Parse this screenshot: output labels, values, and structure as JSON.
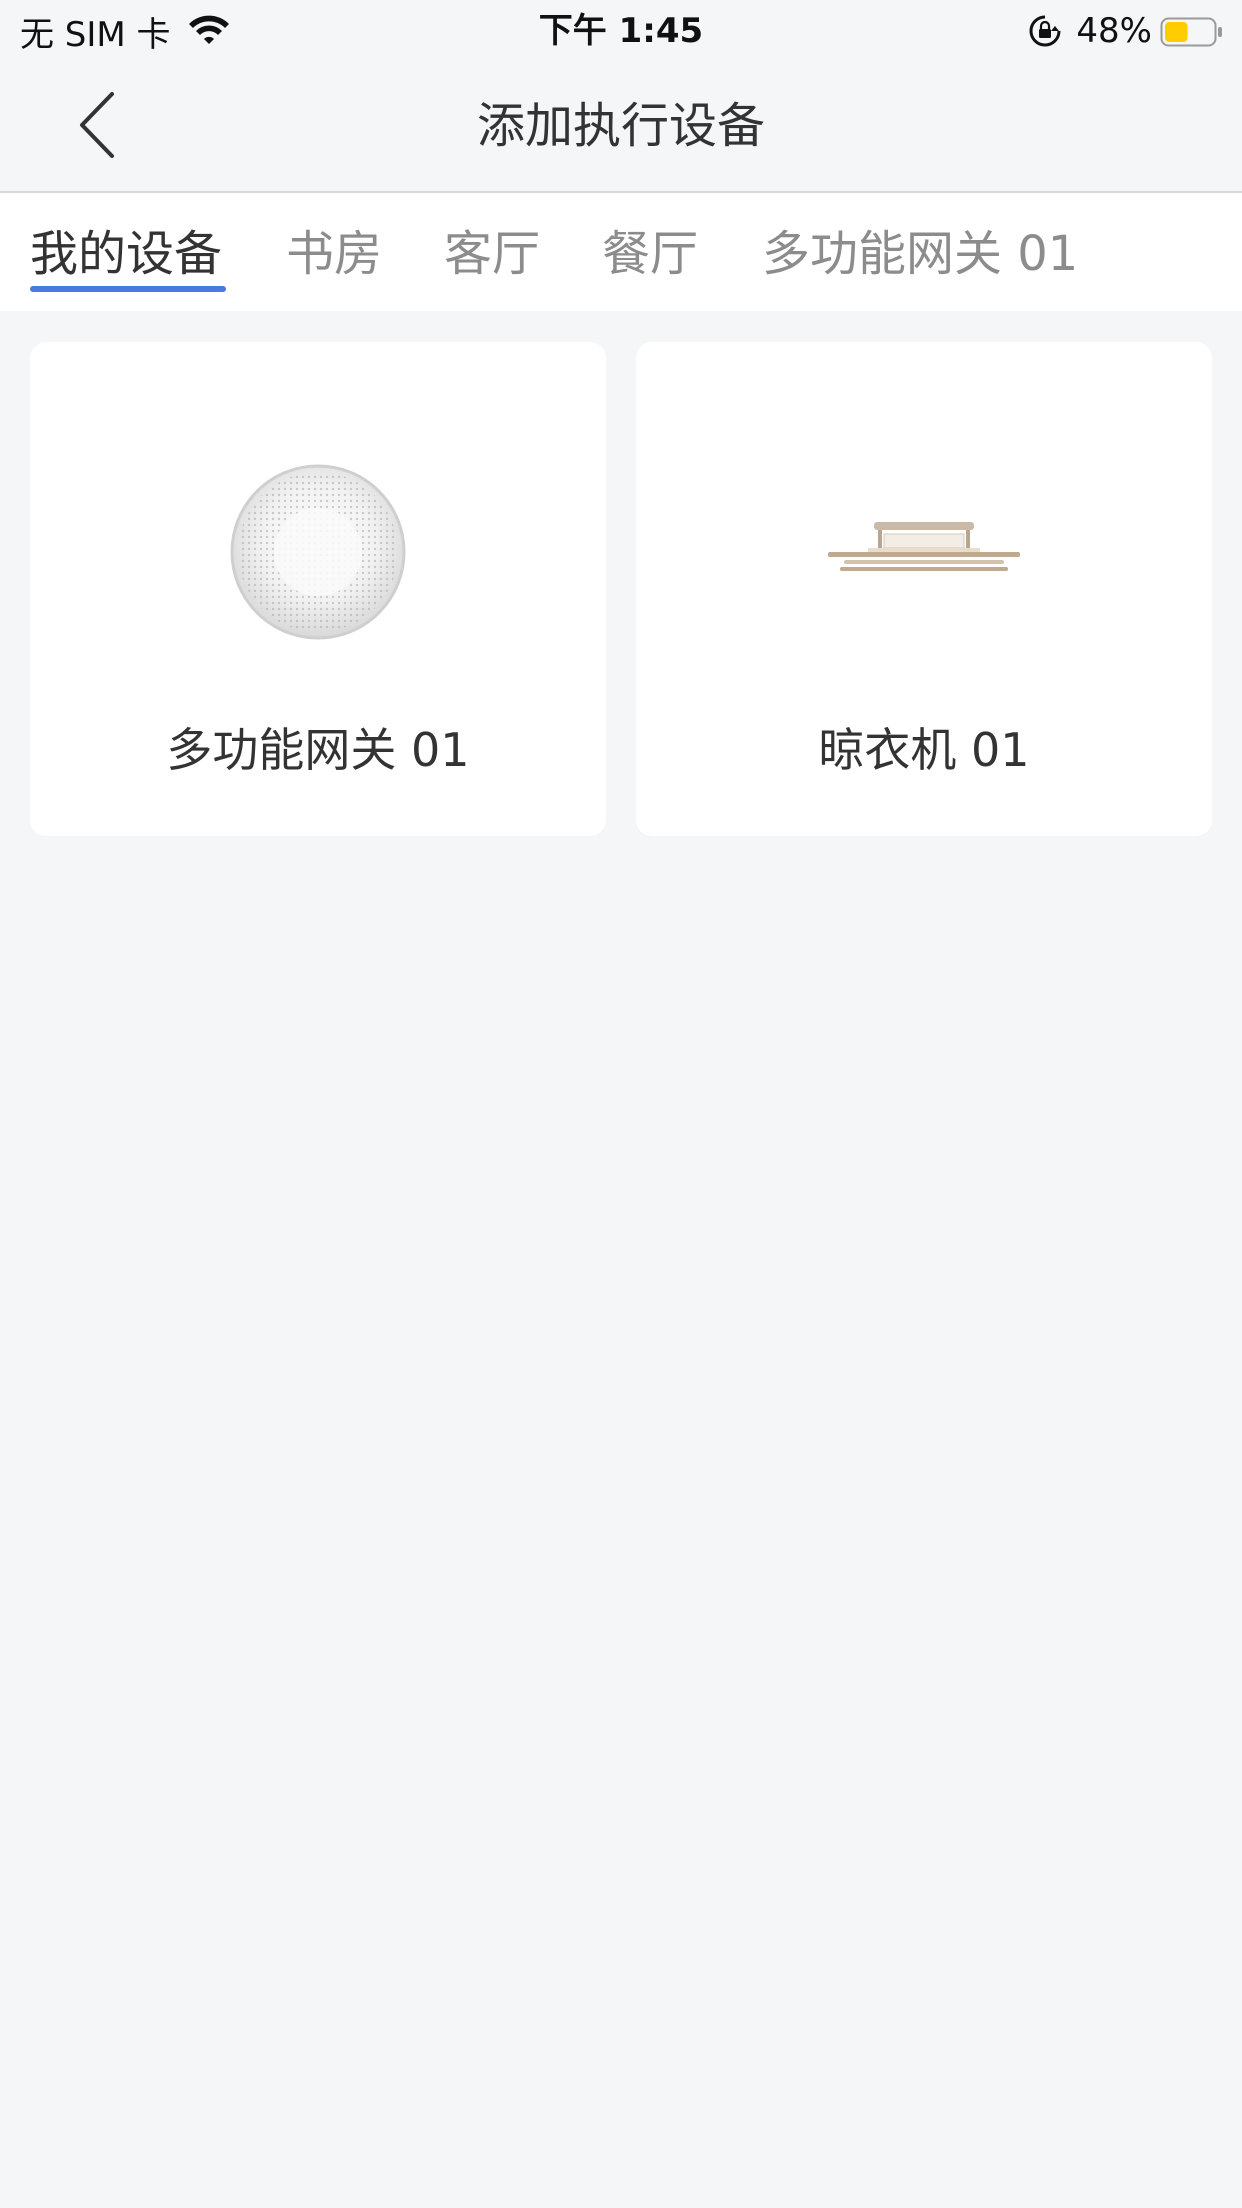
{
  "status_bar": {
    "carrier": "无 SIM 卡",
    "time": "下午 1:45",
    "battery": "48%",
    "battery_level": 0.48,
    "battery_color": "#ffcc00"
  },
  "nav": {
    "title": "添加执行设备",
    "back_icon": "chevron-left-icon"
  },
  "tabs": [
    {
      "label": "我的设备",
      "active": true
    },
    {
      "label": "书房",
      "active": false
    },
    {
      "label": "客厅",
      "active": false
    },
    {
      "label": "餐厅",
      "active": false
    },
    {
      "label": "多功能网关 01",
      "active": false
    }
  ],
  "colors": {
    "accent": "#4a7adf",
    "background": "#f5f6f8"
  },
  "devices": [
    {
      "name": "多功能网关 01",
      "icon": "gateway-device-icon"
    },
    {
      "name": "晾衣机 01",
      "icon": "clothes-dryer-rack-icon"
    }
  ]
}
